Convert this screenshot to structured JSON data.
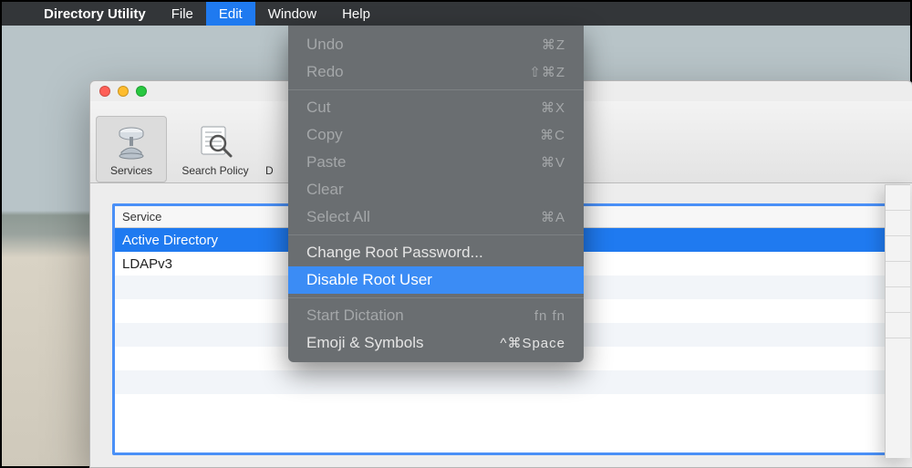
{
  "menubar": {
    "apple_icon": "",
    "app_name": "Directory Utility",
    "items": [
      {
        "label": "File"
      },
      {
        "label": "Edit",
        "active": true
      },
      {
        "label": "Window"
      },
      {
        "label": "Help"
      }
    ]
  },
  "edit_menu": {
    "undo": {
      "label": "Undo",
      "shortcut": "⌘Z"
    },
    "redo": {
      "label": "Redo",
      "shortcut": "⇧⌘Z"
    },
    "cut": {
      "label": "Cut",
      "shortcut": "⌘X"
    },
    "copy": {
      "label": "Copy",
      "shortcut": "⌘C"
    },
    "paste": {
      "label": "Paste",
      "shortcut": "⌘V"
    },
    "clear": {
      "label": "Clear",
      "shortcut": ""
    },
    "select_all": {
      "label": "Select All",
      "shortcut": "⌘A"
    },
    "change_root": {
      "label": "Change Root Password...",
      "shortcut": ""
    },
    "disable_root": {
      "label": "Disable Root User",
      "shortcut": ""
    },
    "dictation": {
      "label": "Start Dictation",
      "shortcut": "fn fn"
    },
    "emoji": {
      "label": "Emoji & Symbols",
      "shortcut": "^⌘Space"
    }
  },
  "window": {
    "toolbar": {
      "services": "Services",
      "search_policy": "Search Policy",
      "truncated": "D"
    },
    "list": {
      "header": "Service",
      "rows": [
        {
          "label": "Active Directory",
          "selected": true
        },
        {
          "label": "LDAPv3",
          "selected": false
        }
      ]
    }
  }
}
